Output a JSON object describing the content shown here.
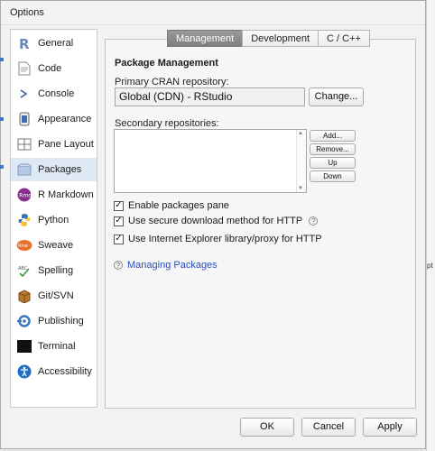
{
  "window": {
    "title": "Options"
  },
  "sidebar": {
    "items": [
      {
        "label": "General",
        "icon": "r-logo-icon"
      },
      {
        "label": "Code",
        "icon": "code-page-icon"
      },
      {
        "label": "Console",
        "icon": "console-prompt-icon"
      },
      {
        "label": "Appearance",
        "icon": "appearance-icon"
      },
      {
        "label": "Pane Layout",
        "icon": "pane-layout-icon"
      },
      {
        "label": "Packages",
        "icon": "packages-icon",
        "selected": true
      },
      {
        "label": "R Markdown",
        "icon": "rmarkdown-icon"
      },
      {
        "label": "Python",
        "icon": "python-icon"
      },
      {
        "label": "Sweave",
        "icon": "sweave-icon"
      },
      {
        "label": "Spelling",
        "icon": "spelling-icon"
      },
      {
        "label": "Git/SVN",
        "icon": "git-svn-icon"
      },
      {
        "label": "Publishing",
        "icon": "publishing-icon"
      },
      {
        "label": "Terminal",
        "icon": "terminal-icon"
      },
      {
        "label": "Accessibility",
        "icon": "accessibility-icon"
      }
    ]
  },
  "tabs": [
    {
      "label": "Management",
      "active": true
    },
    {
      "label": "Development",
      "active": false
    },
    {
      "label": "C / C++",
      "active": false
    }
  ],
  "package_management": {
    "title": "Package Management",
    "primary_label": "Primary CRAN repository:",
    "primary_value": "Global (CDN) - RStudio",
    "change_label": "Change...",
    "secondary_label": "Secondary repositories:",
    "add_label": "Add...",
    "remove_label": "Remove...",
    "up_label": "Up",
    "down_label": "Down",
    "enable_pane_label": "Enable packages pane",
    "secure_download_label": "Use secure download method for HTTP",
    "ie_proxy_label": "Use Internet Explorer library/proxy for HTTP",
    "help_link": "Managing Packages",
    "help_glyph": "?",
    "checked_glyph": "✓"
  },
  "footer": {
    "ok_label": "OK",
    "cancel_label": "Cancel",
    "apply_label": "Apply"
  },
  "background": {
    "right_edge_text": "pt"
  },
  "colors": {
    "selection": "#dfe9f5",
    "active_tab": "#8c8c8c",
    "link": "#2a4cc3"
  }
}
